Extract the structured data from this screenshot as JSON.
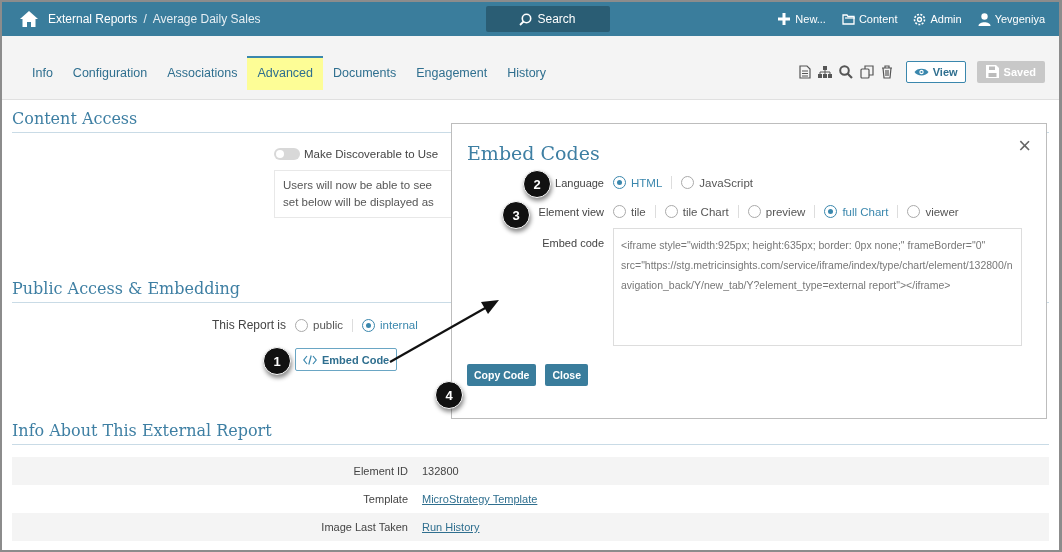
{
  "header": {
    "breadcrumb": "External Reports",
    "separator": "/",
    "page_title": "Average Daily Sales",
    "search": "Search",
    "menu": [
      {
        "label": "New...",
        "kind": "new"
      },
      {
        "label": "Content",
        "kind": "content"
      },
      {
        "label": "Admin",
        "kind": "admin"
      },
      {
        "label": "Yevgeniya",
        "kind": "user"
      }
    ]
  },
  "tabs": [
    {
      "label": "Info",
      "selected": false
    },
    {
      "label": "Configuration",
      "selected": false
    },
    {
      "label": "Associations",
      "selected": false
    },
    {
      "label": "Advanced",
      "selected": true
    },
    {
      "label": "Documents",
      "selected": false
    },
    {
      "label": "Engagement",
      "selected": false
    },
    {
      "label": "History",
      "selected": false
    }
  ],
  "toolbar": {
    "view_button": "View",
    "saved_button": {
      "label": "Saved",
      "disabled": true
    }
  },
  "content_access": {
    "title": "Content Access",
    "toggle": {
      "label": "Make Discoverable to Use",
      "on": false
    },
    "note": [
      "Users will now be able to see",
      "set below will be displayed as"
    ]
  },
  "public_access": {
    "title": "Public Access & Embedding",
    "visibility": {
      "label": "This Report is",
      "options": [
        {
          "label": "public",
          "selected": false
        },
        {
          "label": "internal",
          "selected": true
        }
      ]
    },
    "embed_button": "Embed Code"
  },
  "info": {
    "title": "Info About This External Report",
    "rows": [
      {
        "label": "Element ID",
        "value": "132800",
        "kind": "text"
      },
      {
        "label": "Template",
        "value": "MicroStrategy Template",
        "kind": "link"
      },
      {
        "label": "Image Last Taken",
        "value": "Run History",
        "kind": "link"
      }
    ]
  },
  "modal": {
    "title": "Embed Codes",
    "close": "×",
    "language": {
      "label": "Language",
      "options": [
        {
          "label": "HTML",
          "selected": true
        },
        {
          "label": "JavaScript",
          "selected": false
        }
      ]
    },
    "element_view": {
      "label": "Element view",
      "options": [
        {
          "label": "tile",
          "selected": false
        },
        {
          "label": "tile Chart",
          "selected": false
        },
        {
          "label": "preview",
          "selected": false
        },
        {
          "label": "full Chart",
          "selected": true
        },
        {
          "label": "viewer",
          "selected": false
        }
      ]
    },
    "embed_code": {
      "label": "Embed code",
      "value": "<iframe style=\"width:925px; height:635px; border: 0px none;\" frameBorder=\"0\" src=\"https://stg.metricinsights.com/service/iframe/index/type/chart/element/132800/navigation_back/Y/new_tab/Y?element_type=external report\"></iframe>"
    },
    "buttons": [
      "Copy Code",
      "Close"
    ]
  },
  "callouts": [
    {
      "number": "1"
    },
    {
      "number": "2"
    },
    {
      "number": "3"
    },
    {
      "number": "4"
    }
  ]
}
